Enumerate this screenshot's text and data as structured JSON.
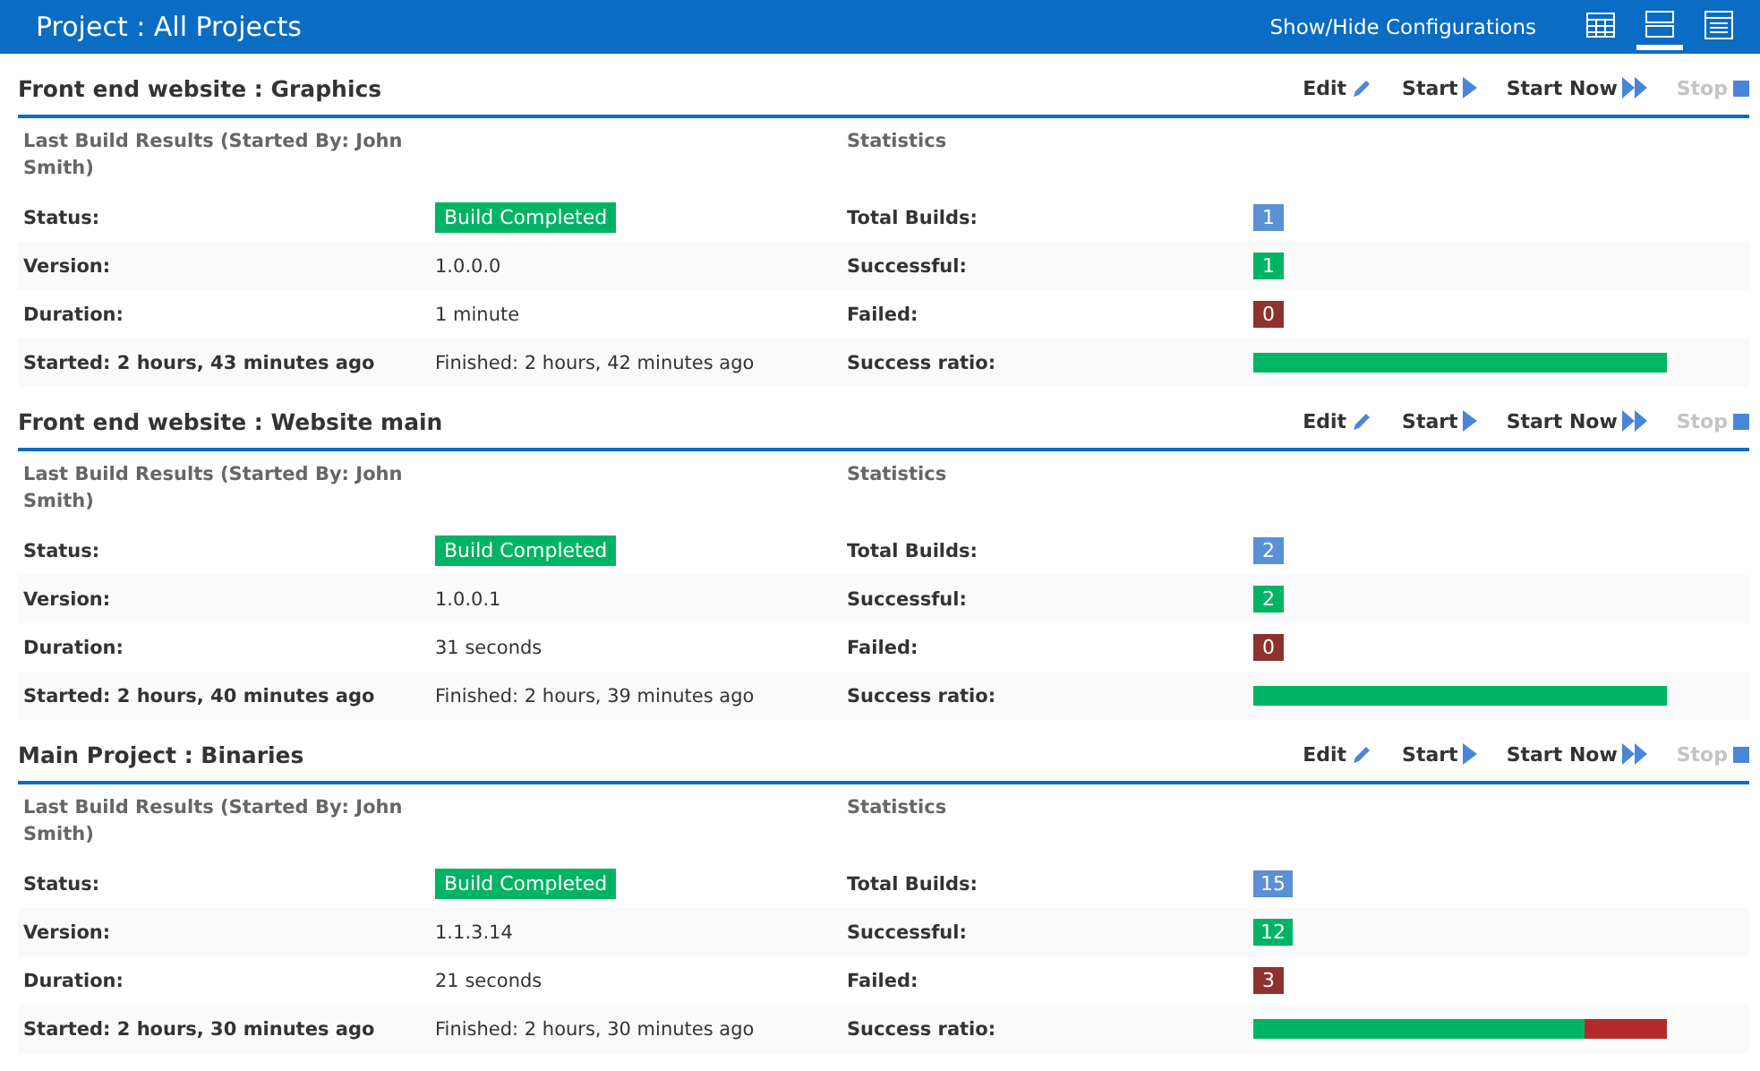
{
  "header": {
    "title": "Project : All Projects",
    "configurations_link": "Show/Hide Configurations",
    "view_modes": [
      {
        "kind": "grid",
        "selected": false
      },
      {
        "kind": "rows",
        "selected": true
      },
      {
        "kind": "list",
        "selected": false
      }
    ]
  },
  "projects": [
    {
      "title": "Front end website : Graphics",
      "actions": [
        {
          "kind": "edit",
          "label": "Edit",
          "disabled": false
        },
        {
          "kind": "start",
          "label": "Start",
          "disabled": false
        },
        {
          "kind": "start_now",
          "label": "Start Now",
          "disabled": false
        },
        {
          "kind": "stop",
          "label": "Stop",
          "disabled": true
        }
      ],
      "results_heading": "Last Build Results (Started By: John Smith)",
      "statistics_heading": "Statistics",
      "rows": [
        {
          "label": "Status:",
          "value": "Build Completed",
          "kind": "badge",
          "stat": {
            "kind": "total",
            "label": "Total Builds:",
            "value": "1"
          }
        },
        {
          "label": "Version:",
          "value": "1.0.0.0",
          "kind": "text",
          "stat": {
            "kind": "success",
            "label": "Successful:",
            "value": "1"
          }
        },
        {
          "label": "Duration:",
          "value": "1 minute",
          "kind": "text",
          "stat": {
            "kind": "failed",
            "label": "Failed:",
            "value": "0"
          }
        },
        {
          "label": "Started: 2 hours, 43 minutes ago",
          "value": "Finished: 2 hours, 42 minutes ago",
          "kind": "text",
          "stat": {
            "kind": "ratio",
            "label": "Success ratio:",
            "level": 1
          }
        }
      ]
    },
    {
      "title": "Front end website : Website main",
      "actions": [
        {
          "kind": "edit",
          "label": "Edit",
          "disabled": false
        },
        {
          "kind": "start",
          "label": "Start",
          "disabled": false
        },
        {
          "kind": "start_now",
          "label": "Start Now",
          "disabled": false
        },
        {
          "kind": "stop",
          "label": "Stop",
          "disabled": true
        }
      ],
      "results_heading": "Last Build Results (Started By: John Smith)",
      "statistics_heading": "Statistics",
      "rows": [
        {
          "label": "Status:",
          "value": "Build Completed",
          "kind": "badge",
          "stat": {
            "kind": "total",
            "label": "Total Builds:",
            "value": "2"
          }
        },
        {
          "label": "Version:",
          "value": "1.0.0.1",
          "kind": "text",
          "stat": {
            "kind": "success",
            "label": "Successful:",
            "value": "2"
          }
        },
        {
          "label": "Duration:",
          "value": "31 seconds",
          "kind": "text",
          "stat": {
            "kind": "failed",
            "label": "Failed:",
            "value": "0"
          }
        },
        {
          "label": "Started: 2 hours, 40 minutes ago",
          "value": "Finished: 2 hours, 39 minutes ago",
          "kind": "text",
          "stat": {
            "kind": "ratio",
            "label": "Success ratio:",
            "level": 1
          }
        }
      ]
    },
    {
      "title": "Main Project : Binaries",
      "actions": [
        {
          "kind": "edit",
          "label": "Edit",
          "disabled": false
        },
        {
          "kind": "start",
          "label": "Start",
          "disabled": false
        },
        {
          "kind": "start_now",
          "label": "Start Now",
          "disabled": false
        },
        {
          "kind": "stop",
          "label": "Stop",
          "disabled": true
        }
      ],
      "results_heading": "Last Build Results (Started By: John Smith)",
      "statistics_heading": "Statistics",
      "rows": [
        {
          "label": "Status:",
          "value": "Build Completed",
          "kind": "badge",
          "stat": {
            "kind": "total",
            "label": "Total Builds:",
            "value": "15"
          }
        },
        {
          "label": "Version:",
          "value": "1.1.3.14",
          "kind": "text",
          "stat": {
            "kind": "success",
            "label": "Successful:",
            "value": "12"
          }
        },
        {
          "label": "Duration:",
          "value": "21 seconds",
          "kind": "text",
          "stat": {
            "kind": "failed",
            "label": "Failed:",
            "value": "3"
          }
        },
        {
          "label": "Started: 2 hours, 30 minutes ago",
          "value": "Finished: 2 hours, 30 minutes ago",
          "kind": "text",
          "stat": {
            "kind": "ratio",
            "label": "Success ratio:",
            "level": 0.8
          }
        }
      ]
    }
  ]
}
